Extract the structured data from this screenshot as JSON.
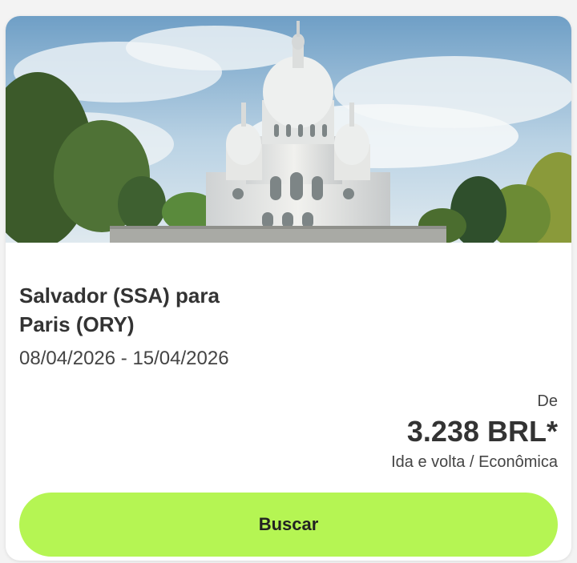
{
  "card": {
    "image_alt": "Sacré-Cœur Basilica, Paris",
    "route_line1": "Salvador (SSA) para",
    "route_line2": "Paris (ORY)",
    "dates": "08/04/2026 - 15/04/2026",
    "price_prefix": "De",
    "price": "3.238 BRL*",
    "price_note": "Ida e volta / Econômica",
    "button_label": "Buscar"
  },
  "colors": {
    "button_bg": "#b5f553",
    "text_primary": "#333333",
    "card_bg": "#ffffff"
  }
}
